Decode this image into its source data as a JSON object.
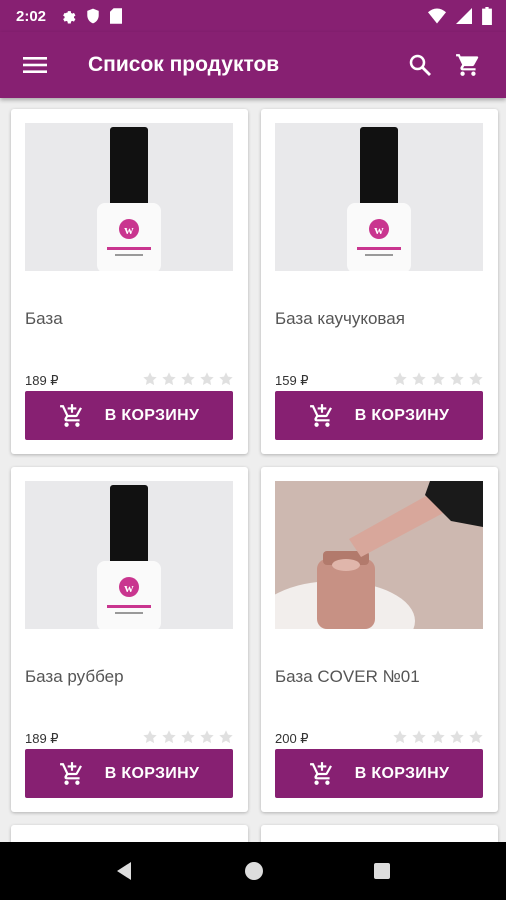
{
  "status": {
    "time": "2:02"
  },
  "app_bar": {
    "title": "Список продуктов",
    "icons": [
      "menu-icon",
      "search-icon",
      "cart-icon"
    ]
  },
  "colors": {
    "primary": "#872072",
    "star": "#e0e0e0"
  },
  "products": [
    {
      "name": "База",
      "price": "189 ₽",
      "button": "В КОРЗИНУ",
      "rating_stars": 0,
      "image": "white-bottle"
    },
    {
      "name": "База каучуковая",
      "price": "159 ₽",
      "button": "В КОРЗИНУ",
      "rating_stars": 0,
      "image": "white-bottle"
    },
    {
      "name": "База руббер",
      "price": "189 ₽",
      "button": "В КОРЗИНУ",
      "rating_stars": 0,
      "image": "white-bottle"
    },
    {
      "name": "База COVER №01",
      "price": "200 ₽",
      "button": "В КОРЗИНУ",
      "rating_stars": 0,
      "image": "brush-jar"
    }
  ],
  "nav": {
    "icons": [
      "back-icon",
      "home-icon",
      "recents-icon"
    ]
  }
}
